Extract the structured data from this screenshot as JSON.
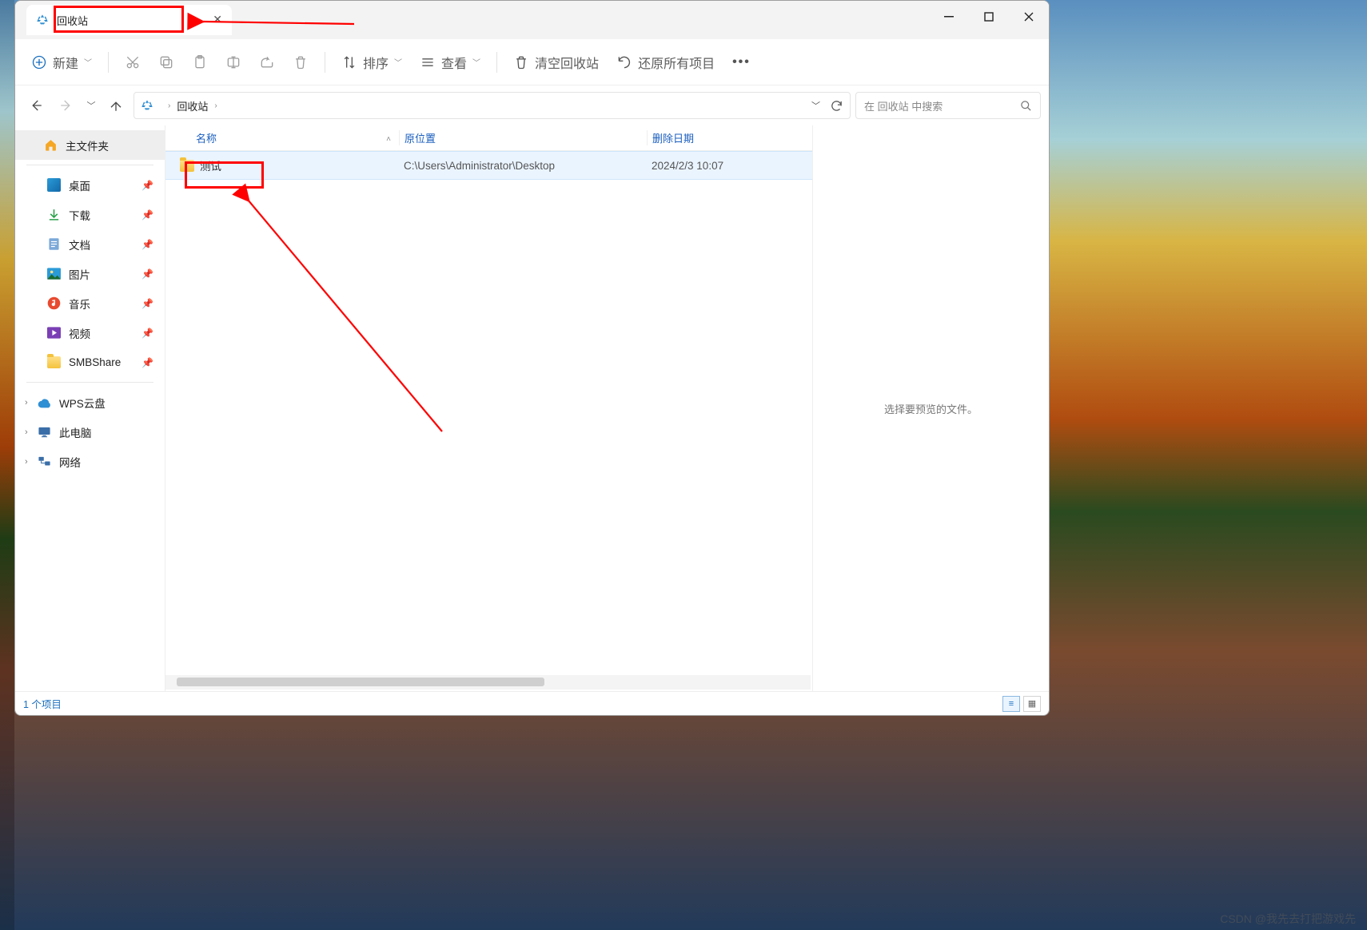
{
  "tab": {
    "title": "回收站"
  },
  "toolbar": {
    "new_label": "新建",
    "sort_label": "排序",
    "view_label": "查看",
    "empty_label": "清空回收站",
    "restore_label": "还原所有项目"
  },
  "breadcrumb": {
    "root": "回收站"
  },
  "search": {
    "placeholder": "在 回收站 中搜索"
  },
  "sidebar": {
    "home": "主文件夹",
    "items": [
      {
        "label": "桌面"
      },
      {
        "label": "下载"
      },
      {
        "label": "文档"
      },
      {
        "label": "图片"
      },
      {
        "label": "音乐"
      },
      {
        "label": "视频"
      },
      {
        "label": "SMBShare"
      }
    ],
    "wps": "WPS云盘",
    "thispc": "此电脑",
    "network": "网络"
  },
  "columns": {
    "name": "名称",
    "orig": "原位置",
    "deleted": "删除日期"
  },
  "rows": [
    {
      "name": "测试",
      "orig": "C:\\Users\\Administrator\\Desktop",
      "deleted": "2024/2/3 10:07"
    }
  ],
  "preview": {
    "empty": "选择要预览的文件。"
  },
  "status": {
    "count": "1 个项目"
  },
  "watermark": "CSDN @我先去打把游戏先"
}
